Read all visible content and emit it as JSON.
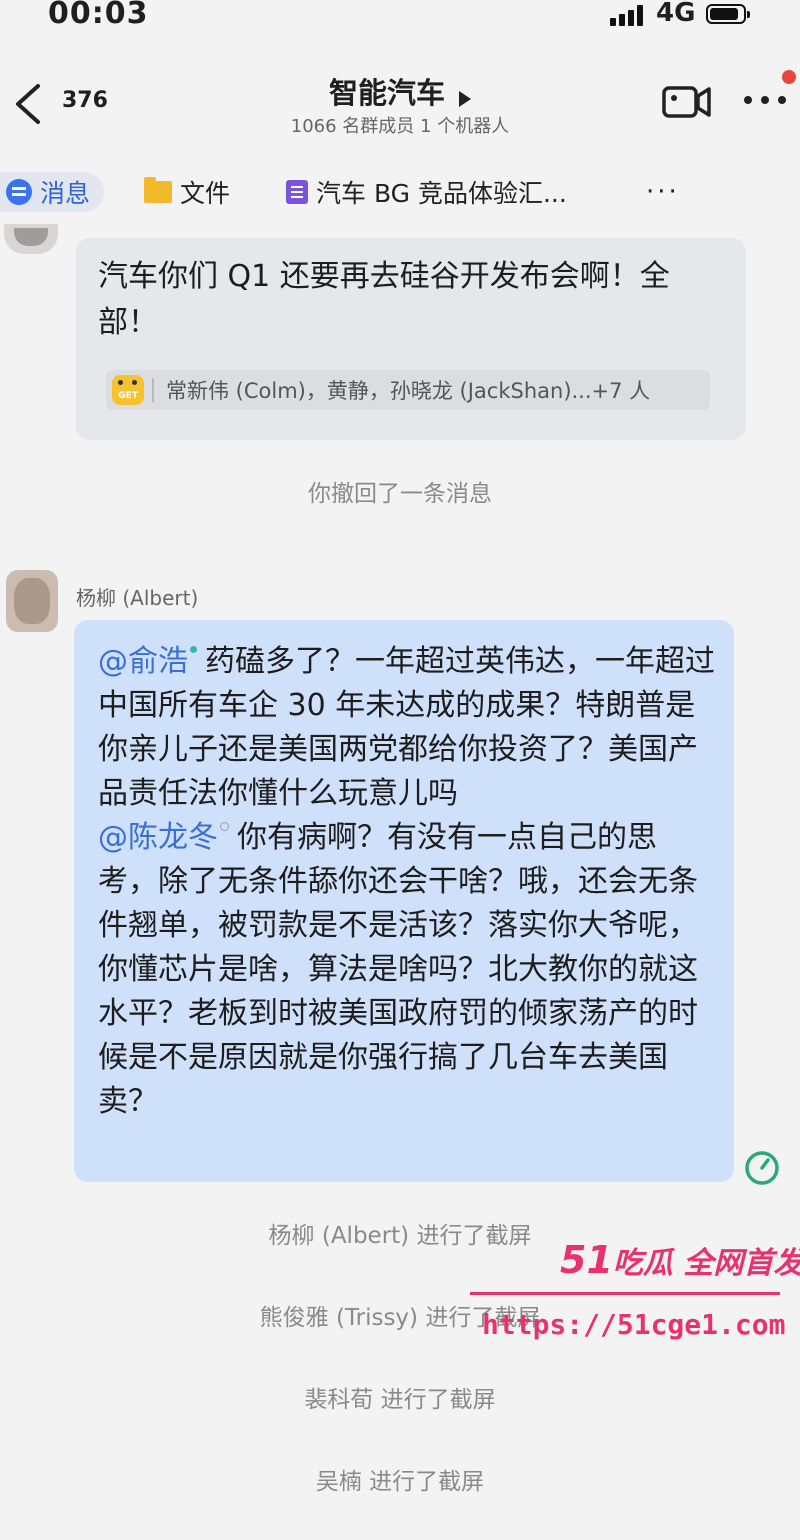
{
  "status": {
    "time": "00:03",
    "network": "4G"
  },
  "header": {
    "back_count": "376",
    "title": "智能汽车",
    "subtitle": "1066 名群成员   1 个机器人"
  },
  "tabs": [
    {
      "label": "消息"
    },
    {
      "label": "文件"
    },
    {
      "label": "汽车 BG 竞品体验汇..."
    },
    {
      "label": "···"
    }
  ],
  "message1": {
    "text": "汽车你们 Q1 还要再去硅谷开发布会啊！全部！",
    "reaction_icon_text": "GET",
    "reaction_users": "常新伟 (Colm)，黄静，孙晓龙 (JackShan)...+7 人"
  },
  "system": {
    "recall": "你撤回了一条消息",
    "screenshot_1": "杨柳 (Albert) 进行了截屏",
    "screenshot_2": "熊俊雅 (Trissy) 进行了截屏",
    "screenshot_3": "裴科荀 进行了截屏",
    "screenshot_4": "吴楠 进行了截屏"
  },
  "message2": {
    "sender": "杨柳 (Albert)",
    "mention1": "@俞浩",
    "text1": "药磕多了？一年超过英伟达，一年超过中国所有车企 30 年未达成的成果？特朗普是你亲儿子还是美国两党都给你投资了？美国产品责任法你懂什么玩意儿吗",
    "mention2": "@陈龙冬",
    "text2": "你有病啊？有没有一点自己的思考，除了无条件舔你还会干啥？哦，还会无条件翘单，被罚款是不是活该？落实你大爷呢，你懂芯片是啥，算法是啥吗？北大教你的就这水平？老板到时被美国政府罚的倾家荡产的时候是不是原因就是你强行搞了几台车去美国卖？"
  },
  "watermark": {
    "logo_num": "51",
    "logo_text": "吃瓜 全网首发",
    "url": "https://51cge1.com"
  }
}
